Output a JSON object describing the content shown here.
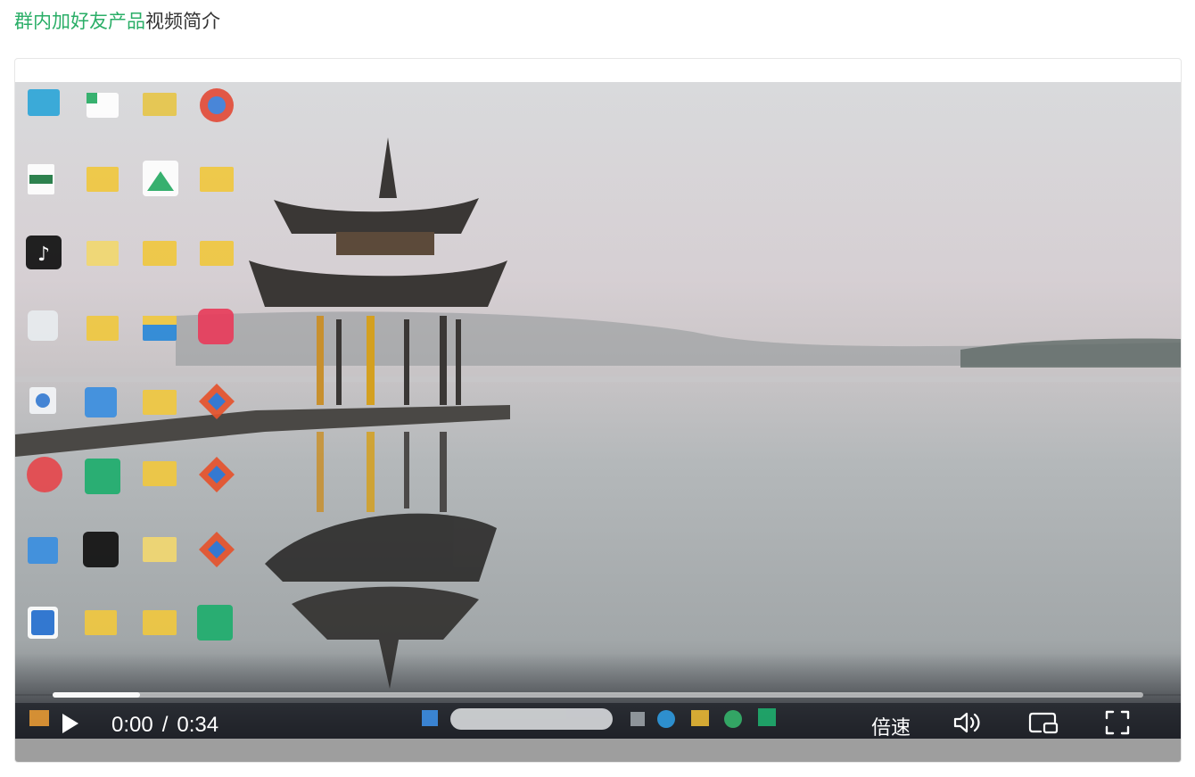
{
  "heading": {
    "link": "群内加好友产品",
    "rest": "视频简介"
  },
  "player": {
    "current_time": "0:00",
    "separator": "/",
    "duration": "0:34",
    "speed_label": "倍速",
    "progress": 0.08,
    "icons": {
      "play": "play-icon",
      "volume": "volume-icon",
      "pip": "picture-in-picture-icon",
      "fullscreen": "fullscreen-icon"
    }
  },
  "colors": {
    "accent": "#2aae67",
    "text": "#333333"
  }
}
